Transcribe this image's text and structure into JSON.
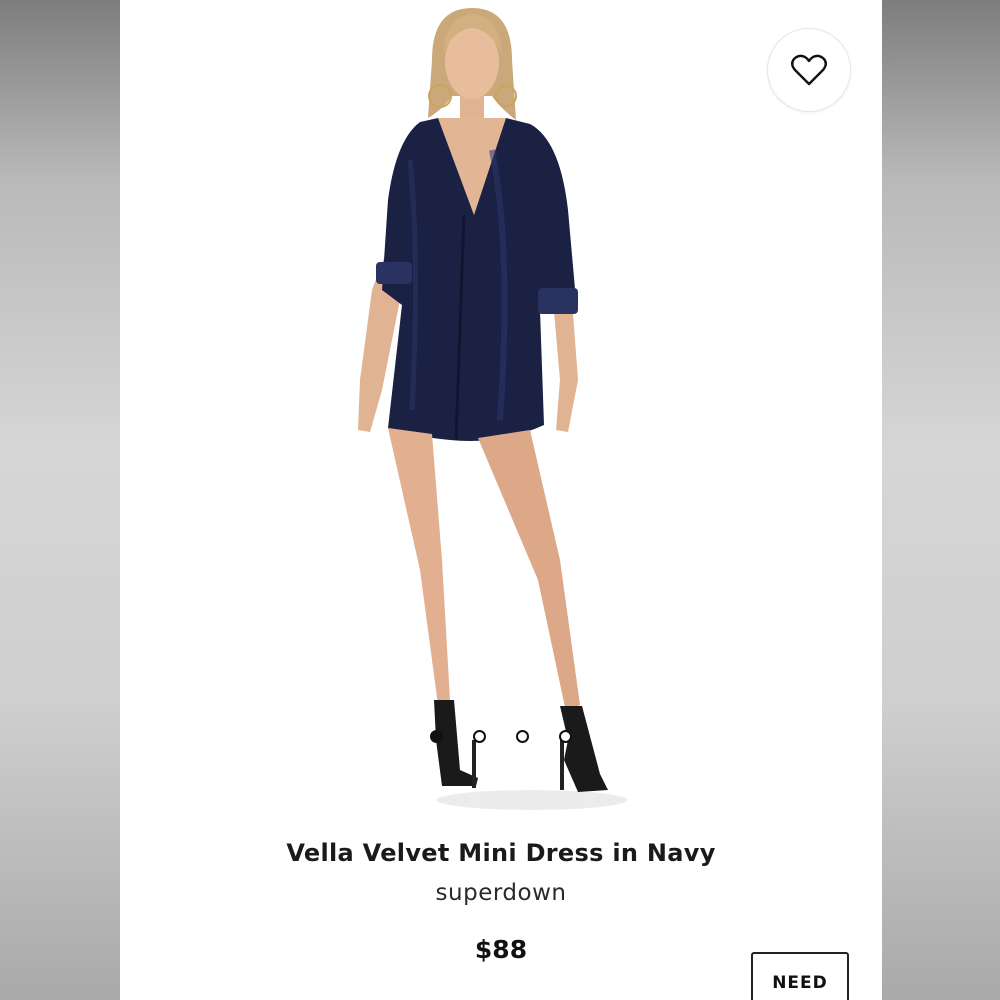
{
  "product": {
    "name": "Vella Velvet Mini Dress in Navy",
    "brand": "superdown",
    "price": "$88"
  },
  "gallery": {
    "image_count": 4,
    "active_index": 0,
    "dress_color": "#1a2040"
  },
  "wishlist": {
    "icon": "heart-outline-icon"
  },
  "actions": {
    "need_label": "NEED"
  }
}
